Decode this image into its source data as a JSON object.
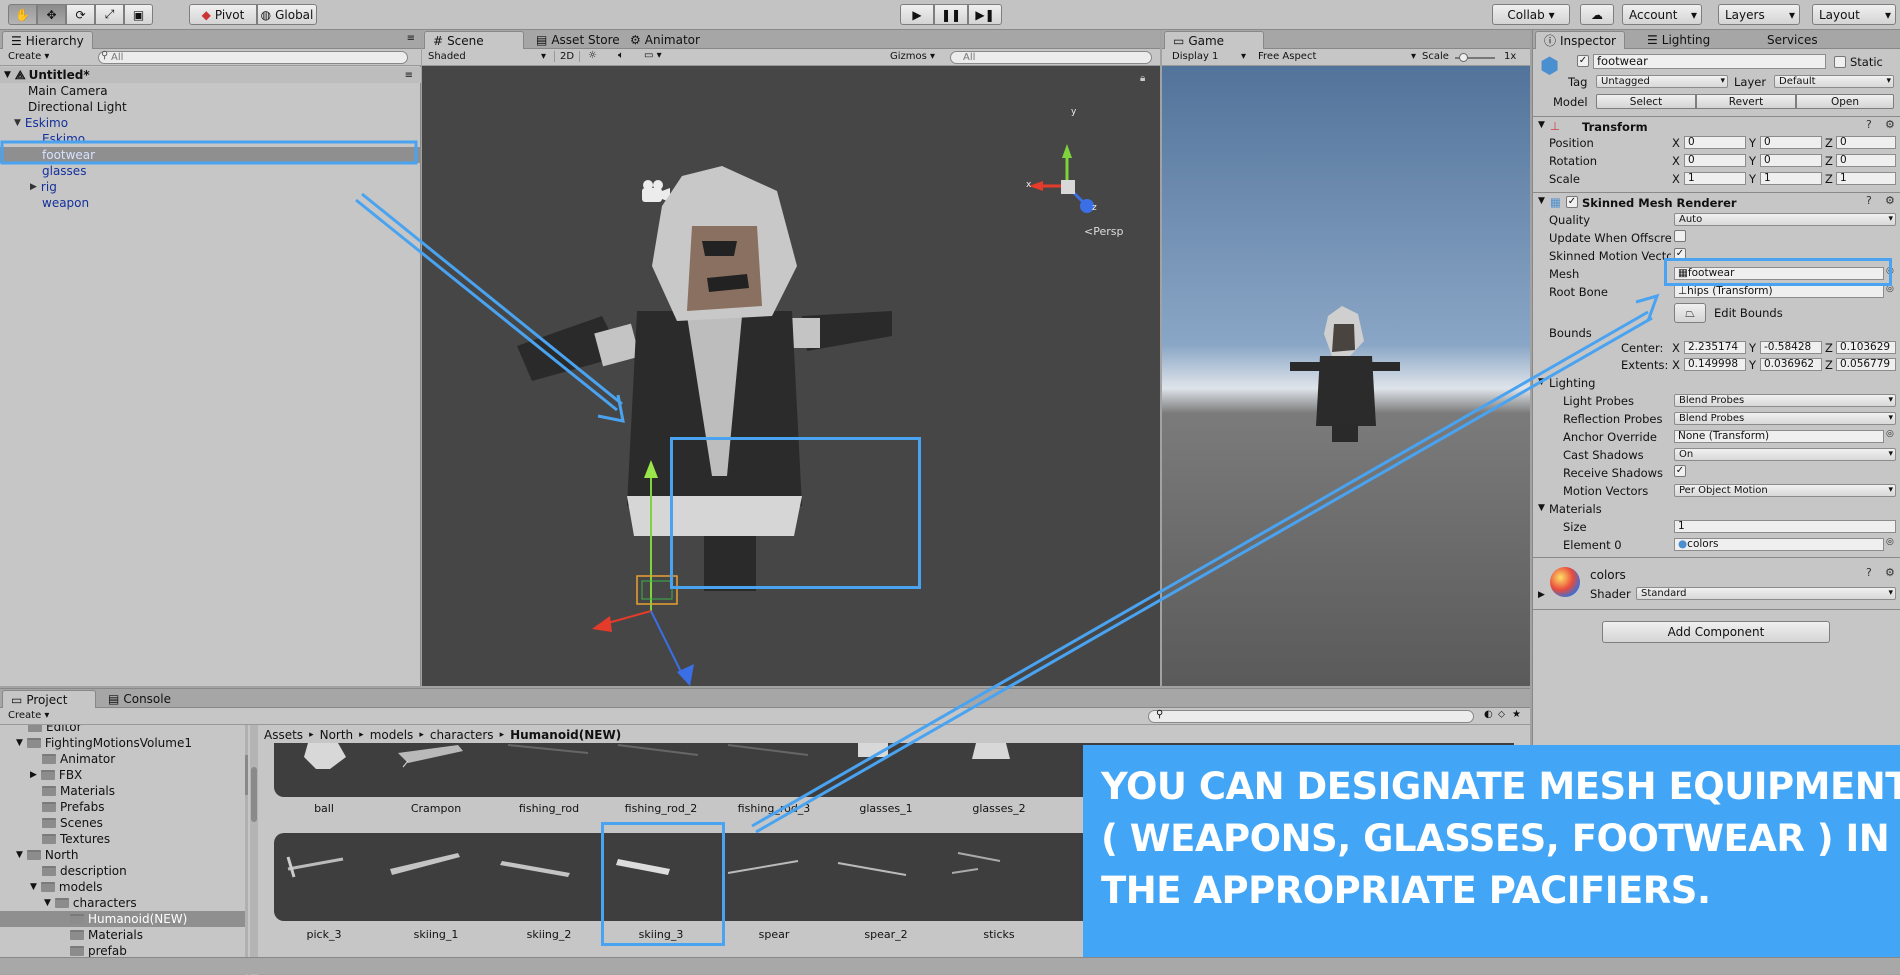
{
  "toolbar": {
    "pivot": "Pivot",
    "global": "Global",
    "collab": "Collab ▾",
    "account": "Account",
    "layers": "Layers",
    "layout": "Layout"
  },
  "hierarchy": {
    "tab": "Hierarchy",
    "create": "Create",
    "search": "All",
    "scene": "Untitled*",
    "items": [
      "Main Camera",
      "Directional Light",
      "Eskimo",
      "Eskimo",
      "footwear",
      "glasses",
      "rig",
      "weapon"
    ]
  },
  "scene": {
    "tabs": [
      "Scene",
      "Asset Store",
      "Animator"
    ],
    "shading": "Shaded",
    "mode2d": "2D",
    "gizmos": "Gizmos",
    "search": "All",
    "persp": "Persp",
    "axis_x": "x",
    "axis_y": "y",
    "axis_z": "z"
  },
  "game": {
    "tab": "Game",
    "display": "Display 1",
    "aspect": "Free Aspect",
    "scale_label": "Scale",
    "scale_value": "1x"
  },
  "inspector": {
    "tabs": [
      "Inspector",
      "Lighting",
      "Services"
    ],
    "name": "footwear",
    "static": "Static",
    "tag_label": "Tag",
    "tag": "Untagged",
    "layer_label": "Layer",
    "layer": "Default",
    "model_label": "Model",
    "select": "Select",
    "revert": "Revert",
    "open": "Open",
    "transform": {
      "title": "Transform",
      "rows": [
        {
          "label": "Position",
          "x": "0",
          "y": "0",
          "z": "0"
        },
        {
          "label": "Rotation",
          "x": "0",
          "y": "0",
          "z": "0"
        },
        {
          "label": "Scale",
          "x": "1",
          "y": "1",
          "z": "1"
        }
      ]
    },
    "smr": {
      "title": "Skinned Mesh Renderer",
      "quality_label": "Quality",
      "quality": "Auto",
      "update_label": "Update When Offscre",
      "motion_label": "Skinned Motion Vecto",
      "mesh_label": "Mesh",
      "mesh": "footwear",
      "root_label": "Root Bone",
      "root": "hips (Transform)",
      "edit_bounds": "Edit Bounds",
      "bounds_label": "Bounds",
      "center_label": "Center:",
      "center": {
        "x": "2.235174",
        "y": "-0.58428",
        "z": "0.103629"
      },
      "extents_label": "Extents:",
      "extents": {
        "x": "0.149998",
        "y": "0.036962",
        "z": "0.056779"
      },
      "lighting": "Lighting",
      "light_probes_label": "Light Probes",
      "light_probes": "Blend Probes",
      "refl_label": "Reflection Probes",
      "refl": "Blend Probes",
      "anchor_label": "Anchor Override",
      "anchor": "None (Transform)",
      "cast_label": "Cast Shadows",
      "cast": "On",
      "recv_label": "Receive Shadows",
      "mv_label": "Motion Vectors",
      "mv": "Per Object Motion",
      "materials": "Materials",
      "size_label": "Size",
      "size": "1",
      "elem_label": "Element 0",
      "elem": "colors"
    },
    "material": {
      "name": "colors",
      "shader_label": "Shader",
      "shader": "Standard"
    },
    "add_component": "Add Component"
  },
  "project": {
    "tabs": [
      "Project",
      "Console"
    ],
    "create": "Create",
    "breadcrumb": [
      "Assets",
      "North",
      "models",
      "characters",
      "Humanoid(NEW)"
    ],
    "tree": [
      "Editor",
      "FightingMotionsVolume1",
      "Animator",
      "FBX",
      "Materials",
      "Prefabs",
      "Scenes",
      "Textures",
      "North",
      "description",
      "models",
      "characters",
      "Humanoid(NEW)",
      "Materials",
      "prefab"
    ],
    "row1": [
      "ball",
      "Crampon",
      "fishing_rod",
      "fishing_rod_2",
      "fishing_rod_3",
      "glasses_1",
      "glasses_2"
    ],
    "row2": [
      "pick_3",
      "skiing_1",
      "skiing_2",
      "skiing_3",
      "spear",
      "spear_2",
      "sticks"
    ]
  },
  "overlay": {
    "line1": "YOU CAN DESIGNATE MESH EQUIPMENT",
    "line2": "( WEAPONS, GLASSES, FOOTWEAR ) IN",
    "line3": "THE APPROPRIATE PACIFIERS."
  },
  "colors": {
    "accent": "#4aa3f0",
    "banner": "#42a5f5"
  }
}
